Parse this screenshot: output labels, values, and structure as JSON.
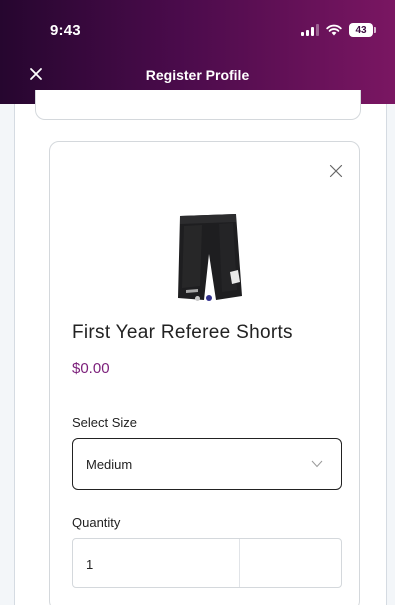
{
  "status_bar": {
    "time": "9:43",
    "battery": "43"
  },
  "nav": {
    "title": "Register Profile",
    "close_icon": "close-icon"
  },
  "product": {
    "name": "First Year Referee Shorts",
    "price": "$0.00",
    "image_icon": "shorts-image",
    "carousel": {
      "count": 2,
      "active": 1
    }
  },
  "size": {
    "label": "Select Size",
    "value": "Medium"
  },
  "quantity": {
    "label": "Quantity",
    "value": "1"
  },
  "colors": {
    "header_start": "#26062f",
    "header_end": "#7a1662",
    "price": "#7b1f7a",
    "active_dot": "#31308c"
  }
}
